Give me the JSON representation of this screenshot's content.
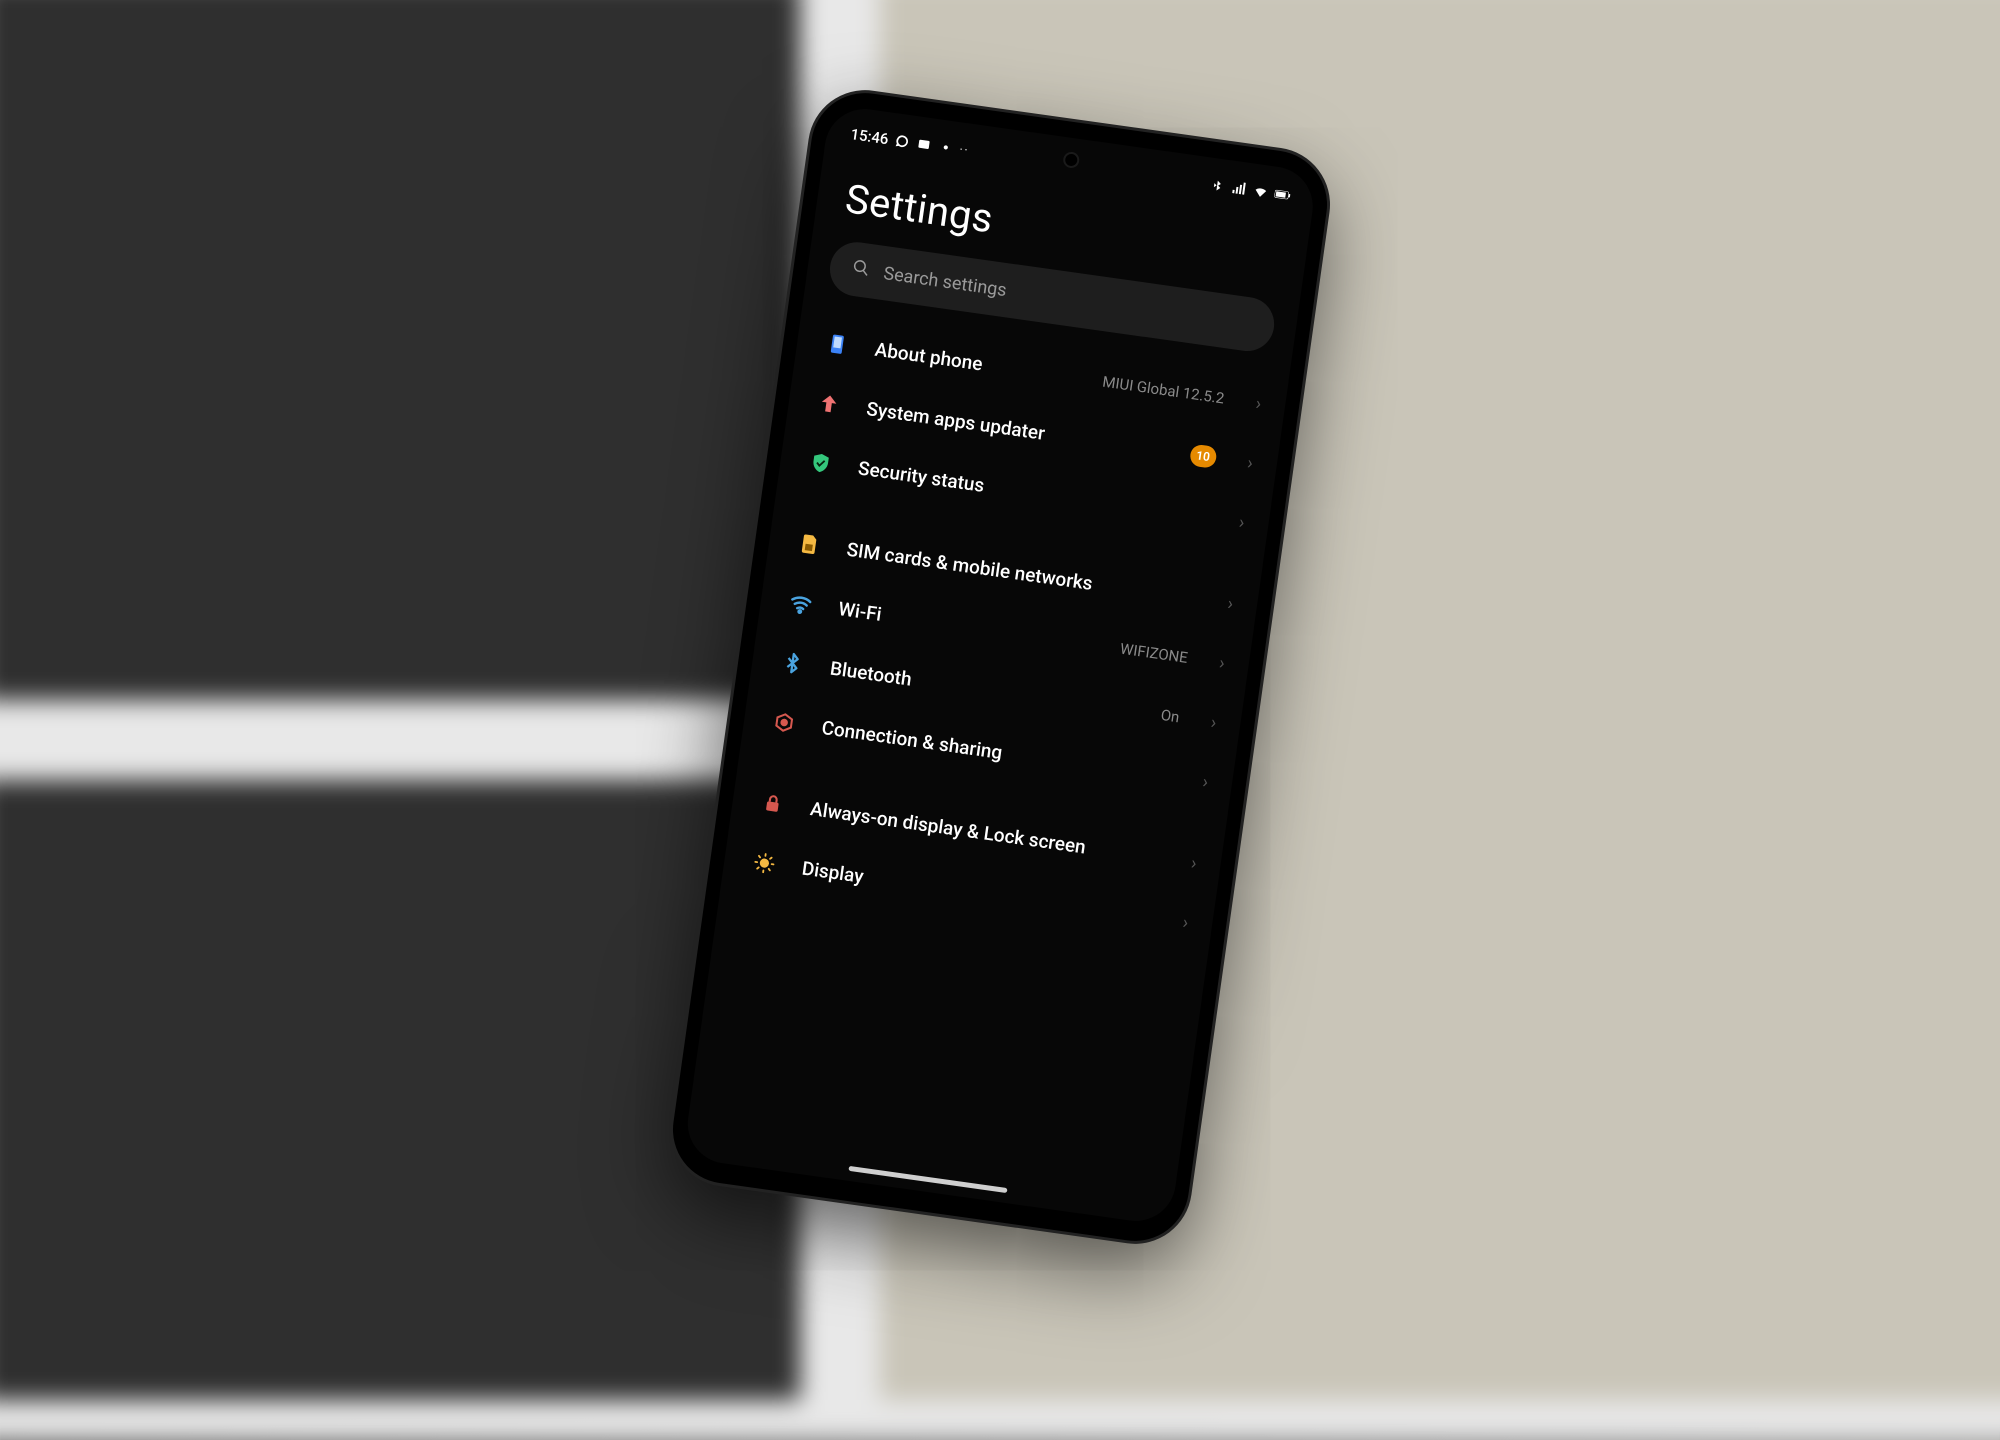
{
  "status_bar": {
    "time": "15:46",
    "left_icons": [
      "whatsapp-icon",
      "movie-icon",
      "notification-dot-icon",
      "more-dots-icon"
    ],
    "right_icons": [
      "bluetooth-icon",
      "signal-icon",
      "wifi-icon",
      "battery-icon"
    ]
  },
  "page_title": "Settings",
  "search": {
    "placeholder": "Search settings"
  },
  "groups": [
    {
      "items": [
        {
          "icon": "phone-info-icon",
          "color": "#3b82f6",
          "label": "About phone",
          "value": "MIUI Global 12.5.2"
        },
        {
          "icon": "arrow-up-icon",
          "color": "#ef7272",
          "label": "System apps updater",
          "badge": "10"
        },
        {
          "icon": "shield-check-icon",
          "color": "#34c77c",
          "label": "Security status"
        }
      ]
    },
    {
      "items": [
        {
          "icon": "sim-card-icon",
          "color": "#f5b942",
          "label": "SIM cards & mobile networks"
        },
        {
          "icon": "wifi-icon",
          "color": "#4aa3df",
          "label": "Wi-Fi",
          "value": "WIFIZONE"
        },
        {
          "icon": "bluetooth-icon",
          "color": "#4aa3df",
          "label": "Bluetooth",
          "value": "On"
        },
        {
          "icon": "connection-sharing-icon",
          "color": "#d6584f",
          "label": "Connection & sharing"
        }
      ]
    },
    {
      "items": [
        {
          "icon": "lock-icon",
          "color": "#d6584f",
          "label": "Always-on display & Lock screen"
        },
        {
          "icon": "brightness-icon",
          "color": "#f5b942",
          "label": "Display"
        }
      ]
    }
  ]
}
